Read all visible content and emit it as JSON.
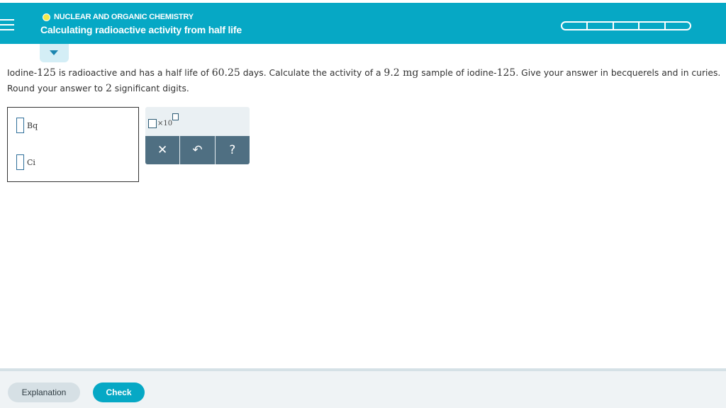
{
  "header": {
    "topic": "NUCLEAR AND ORGANIC CHEMISTRY",
    "title": "Calculating radioactive activity from half life",
    "status_color": "#f3e84a",
    "background": "#06a8c5",
    "progress_segments": 5
  },
  "question": {
    "part1": "Iodine-",
    "isotope1": "125",
    "part2": " is radioactive and has a half life of ",
    "half_life": "60.25",
    "part3": " days. Calculate the activity of a ",
    "mass": "9.2 mg",
    "part4": " sample of iodine-",
    "isotope2": "125",
    "part5": ". Give your answer in becquerels and in curies. Round your answer to ",
    "sig_figs": "2",
    "part6": " significant digits."
  },
  "answers": [
    {
      "unit": "Bq",
      "value": ""
    },
    {
      "unit": "Ci",
      "value": ""
    }
  ],
  "toolbox": {
    "sci_label": "×10",
    "clear_symbol": "✕",
    "undo_symbol": "↶",
    "help_symbol": "?"
  },
  "footer": {
    "explanation_label": "Explanation",
    "check_label": "Check"
  }
}
